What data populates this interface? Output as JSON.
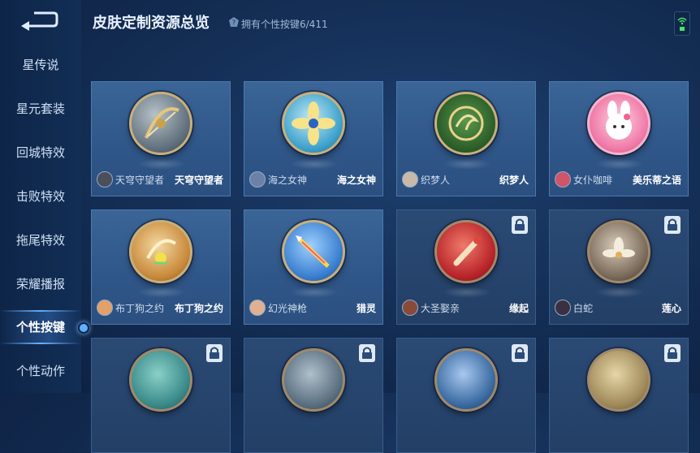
{
  "header": {
    "title": "皮肤定制资源总览",
    "subtitle": "拥有个性按键6/411"
  },
  "sidebar": {
    "items": [
      {
        "label": "星传说"
      },
      {
        "label": "星元套装"
      },
      {
        "label": "回城特效"
      },
      {
        "label": "击败特效"
      },
      {
        "label": "拖尾特效"
      },
      {
        "label": "荣耀播报"
      },
      {
        "label": "个性按键",
        "active": true
      },
      {
        "label": "个性动作"
      }
    ]
  },
  "cards": [
    {
      "hero": "天穹守望者",
      "skin": "天穹守望者",
      "locked": false,
      "theme": "#7d8f9a",
      "icon": "bow-icon"
    },
    {
      "hero": "海之女神",
      "skin": "海之女神",
      "locked": false,
      "theme": "#4fb3d6",
      "icon": "flower-icon"
    },
    {
      "hero": "织梦人",
      "skin": "织梦人",
      "locked": false,
      "theme": "#3c7a3a",
      "icon": "dragon-emblem-icon"
    },
    {
      "hero": "女仆咖啡",
      "skin": "美乐蒂之语",
      "locked": false,
      "theme": "#f08ab4",
      "icon": "melody-icon"
    },
    {
      "hero": "布丁狗之约",
      "skin": "布丁狗之约",
      "locked": false,
      "theme": "#c98a3c",
      "icon": "bow-ribbon-icon"
    },
    {
      "hero": "幻光神枪",
      "skin": "猎灵",
      "locked": false,
      "theme": "#3a7fd0",
      "icon": "spear-icon"
    },
    {
      "hero": "大圣娶亲",
      "skin": "缘起",
      "locked": true,
      "theme": "#b8242a",
      "icon": "scroll-icon"
    },
    {
      "hero": "白蛇",
      "skin": "莲心",
      "locked": true,
      "theme": "#7a6a5a",
      "icon": "lotus-icon"
    },
    {
      "hero": "",
      "skin": "",
      "locked": true,
      "theme": "#3a8a8a",
      "icon": "partial-icon"
    },
    {
      "hero": "",
      "skin": "",
      "locked": true,
      "theme": "#5a6f80",
      "icon": "partial-icon"
    },
    {
      "hero": "",
      "skin": "",
      "locked": true,
      "theme": "#3a6aa0",
      "icon": "partial-icon"
    },
    {
      "hero": "",
      "skin": "",
      "locked": true,
      "theme": "#a08a5a",
      "icon": "partial-icon"
    }
  ]
}
